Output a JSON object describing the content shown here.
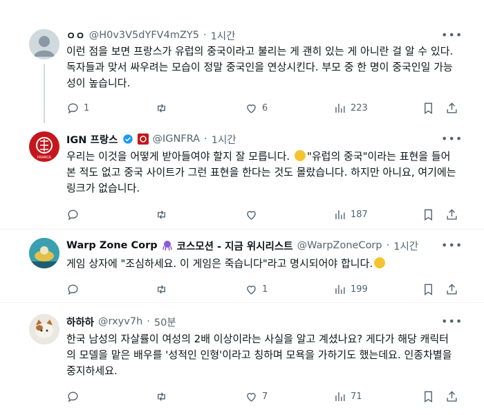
{
  "tweets": [
    {
      "name": "ㅇㅇ",
      "handle": "@H0v3V5dYFV4mZY5",
      "dot": "·",
      "time": "1시간",
      "text": "이런 점을 보면 프랑스가 유럽의 중국이라고 불리는 게 괜히 있는 게 아니란 걸 알 수 있다. 독자들과 맞서 싸우려는 모습이 정말 중국인을 연상시킨다. 부모 중 한 명이 중국인일 가능성이 높습니다.",
      "replies": "1",
      "retweets": "",
      "likes": "6",
      "views": "223"
    },
    {
      "name": "IGN 프랑스",
      "handle": "@IGNFRA",
      "dot": "·",
      "time": "1시간",
      "text_before_emoji": "우리는 이것을 어떻게 받아들여야 할지 잘 모릅니다. ",
      "text_after_emoji": "\"유럽의 중국\"이라는 표현을 들어본 적도 없고 중국 사이트가 그런 표현을 한다는 것도 몰랐습니다. 하지만 아니요, 여기에는 링크가 없습니다.",
      "avatar_label": "FRANCE",
      "replies": "",
      "retweets": "",
      "likes": "",
      "views": "187"
    },
    {
      "name": "Warp Zone Corp",
      "name_suffix": "코스모션 - 지금 위시리스트",
      "handle": "@WarpZoneCorp",
      "dot": "·",
      "time": "1시간",
      "text": "게임 상자에 \"조심하세요. 이 게임은 죽습니다\"라고 명시되어야 합니다.",
      "replies": "",
      "retweets": "",
      "likes": "1",
      "views": "199"
    },
    {
      "name": "하하하",
      "handle": "@rxyv7h",
      "dot": "·",
      "time": "50분",
      "text": "한국 남성의 자살률이 여성의 2배 이상이라는 사실을 알고 계셨나요? 게다가 해당 캐릭터의 모델을 맡은 배우를 '성적인 인형'이라고 칭하며 모욕을 가하기도 했는데요. 인종차별을 중지하세요.",
      "replies": "",
      "retweets": "",
      "likes": "7",
      "views": "71"
    }
  ],
  "icons": {
    "more": "more-options-icon",
    "reply": "reply-icon",
    "retweet": "retweet-icon",
    "like": "heart-icon",
    "views": "views-icon",
    "bookmark": "bookmark-icon",
    "share": "share-icon"
  },
  "colors": {
    "text": "#0f1419",
    "muted": "#536471",
    "verified": "#1d9bf0",
    "ign_red": "#c4161c",
    "thread_line": "#cfd9de"
  }
}
